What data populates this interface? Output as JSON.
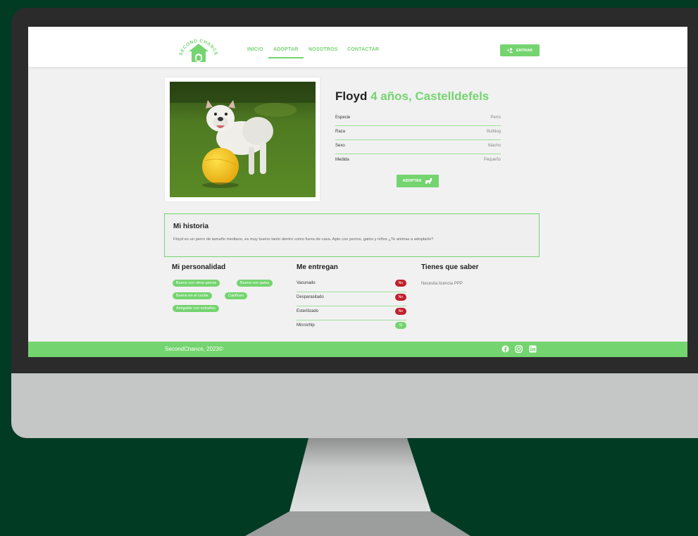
{
  "colors": {
    "accent": "#74d46f",
    "background": "#013b24",
    "no_badge": "#c0202a"
  },
  "logo": {
    "text": "SECOND CHANCE"
  },
  "nav": {
    "links": [
      "INICIO",
      "ADOPTAR",
      "NOSOTROS",
      "CONTACTAR"
    ],
    "active": "ADOPTAR",
    "login_label": "ENTRAR",
    "login_icon": "user-plus-icon"
  },
  "pet": {
    "name": "Floyd",
    "subtitle": "4 años, Castelldefels",
    "details": [
      {
        "label": "Especie",
        "value": "Perro"
      },
      {
        "label": "Raza",
        "value": "Bulldog"
      },
      {
        "label": "Sexo",
        "value": "Macho"
      },
      {
        "label": "Medida",
        "value": "Pequeño"
      }
    ],
    "adopt_label": "ADOPTAR",
    "adopt_icon": "dog-icon"
  },
  "story": {
    "title": "Mi historia",
    "text": "Floyd es un perro de tamaño mediano, es muy bueno tanto dentro como fuera de casa. Apto con perros, gatos y niños ¿Te animas a adoptarlo?"
  },
  "personality": {
    "title": "Mi personalidad",
    "chips": [
      "Bueno con otros perros",
      "Bueno con gatos",
      "Bueno en el coche",
      "Cariñoso",
      "Amigable con extraños"
    ]
  },
  "delivery": {
    "title": "Me entregan",
    "items": [
      {
        "label": "Vacunado",
        "status": "No"
      },
      {
        "label": "Desparasitado",
        "status": "No"
      },
      {
        "label": "Esterilizado",
        "status": "No"
      },
      {
        "label": "Microchip",
        "status": "Sí"
      }
    ]
  },
  "know": {
    "title": "Tienes que saber",
    "text": "Necesita licencia PPP"
  },
  "footer": {
    "text": "SecondChance, 2023©",
    "social": [
      "facebook-icon",
      "instagram-icon",
      "linkedin-icon"
    ]
  }
}
